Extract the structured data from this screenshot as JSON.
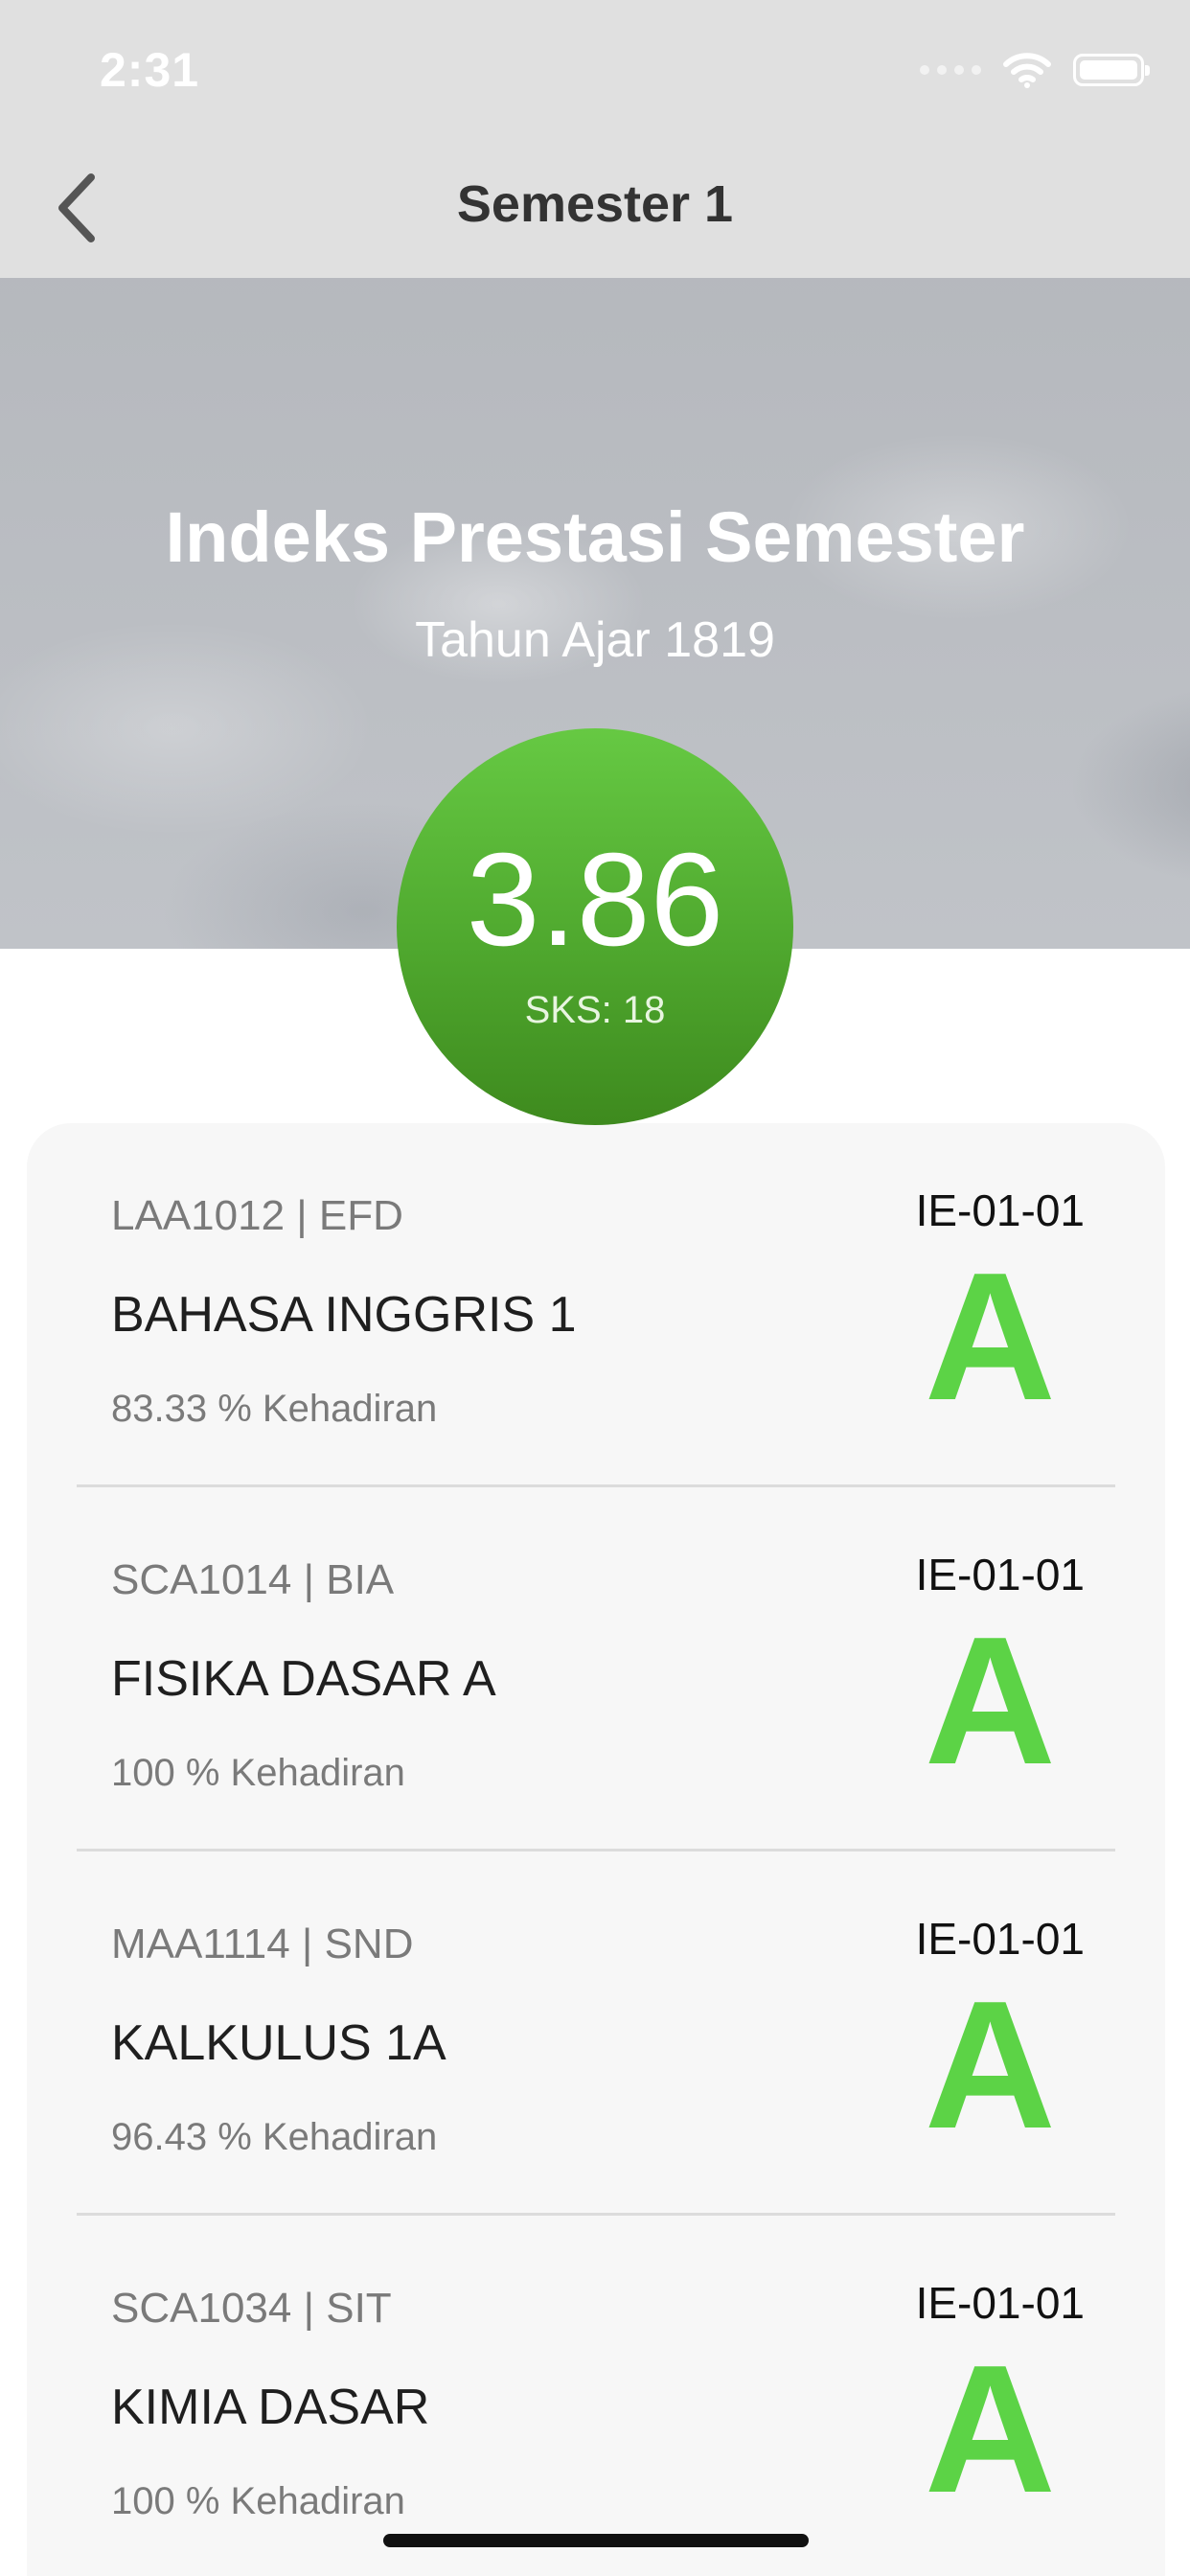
{
  "status_bar": {
    "time": "2:31"
  },
  "nav": {
    "title": "Semester 1"
  },
  "hero": {
    "title": "Indeks Prestasi Semester",
    "subtitle": "Tahun Ajar 1819"
  },
  "gpa": {
    "value": "3.86",
    "sks": "SKS: 18"
  },
  "courses": [
    {
      "code": "LAA1012 | EFD",
      "name": "BAHASA INGGRIS 1",
      "attendance": "83.33 % Kehadiran",
      "class": "IE-01-01",
      "grade": "A"
    },
    {
      "code": "SCA1014 | BIA",
      "name": "FISIKA DASAR A",
      "attendance": "100 % Kehadiran",
      "class": "IE-01-01",
      "grade": "A"
    },
    {
      "code": "MAA1114 | SND",
      "name": "KALKULUS 1A",
      "attendance": "96.43 % Kehadiran",
      "class": "IE-01-01",
      "grade": "A"
    },
    {
      "code": "SCA1034 | SIT",
      "name": "KIMIA DASAR",
      "attendance": "100 % Kehadiran",
      "class": "IE-01-01",
      "grade": "A"
    }
  ],
  "colors": {
    "grade": "#5cd346",
    "gpa_circle": "#4fa82e",
    "nav_bar": "#e0e0e0"
  },
  "icons": {
    "back": "chevron-left-icon",
    "wifi": "wifi-icon",
    "battery": "battery-icon",
    "signal": "signal-icon"
  }
}
